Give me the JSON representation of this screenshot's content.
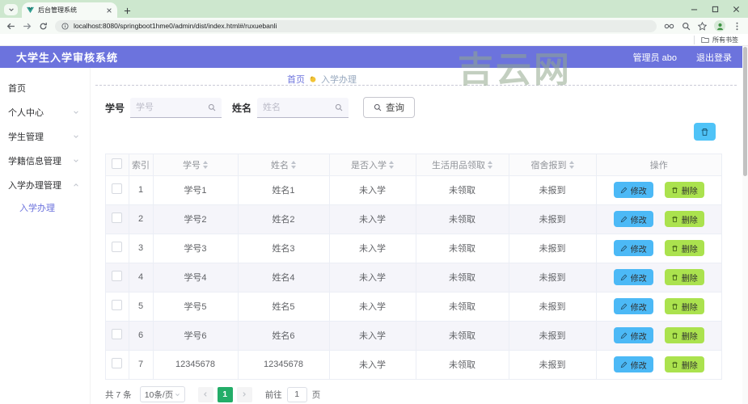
{
  "colors": {
    "accent": "#6c73dd",
    "edit_button": "#4cb9f6",
    "delete_button": "#abe24e",
    "page_active": "#23ad68",
    "batch_button": "#4fc3f7"
  },
  "browser": {
    "tab_title": "后台管理系统",
    "url": "localhost:8080/springboot1hme0/admin/dist/index.html#/ruxuebanli",
    "bookmarks_label": "所有书签"
  },
  "watermark": "吉云网",
  "app_header": {
    "title": "大学生入学审核系统",
    "user": "管理员 abo",
    "logout": "退出登录"
  },
  "breadcrumb": {
    "home": "首页",
    "current": "入学办理"
  },
  "sidebar": {
    "items": [
      {
        "label": "首页",
        "expandable": false
      },
      {
        "label": "个人中心",
        "expandable": true
      },
      {
        "label": "学生管理",
        "expandable": true
      },
      {
        "label": "学籍信息管理",
        "expandable": true
      },
      {
        "label": "入学办理管理",
        "expandable": true,
        "children": [
          {
            "label": "入学办理",
            "active": true
          }
        ]
      }
    ]
  },
  "search": {
    "id_label": "学号",
    "id_placeholder": "学号",
    "name_label": "姓名",
    "name_placeholder": "姓名",
    "query_label": "查询"
  },
  "table": {
    "headers": [
      "索引",
      "学号",
      "姓名",
      "是否入学",
      "生活用品领取",
      "宿舍报到",
      "操作"
    ],
    "edit_label": "修改",
    "delete_label": "删除",
    "rows": [
      {
        "index": "1",
        "student_id": "学号1",
        "name": "姓名1",
        "enrolled": "未入学",
        "supplies": "未领取",
        "dorm": "未报到"
      },
      {
        "index": "2",
        "student_id": "学号2",
        "name": "姓名2",
        "enrolled": "未入学",
        "supplies": "未领取",
        "dorm": "未报到"
      },
      {
        "index": "3",
        "student_id": "学号3",
        "name": "姓名3",
        "enrolled": "未入学",
        "supplies": "未领取",
        "dorm": "未报到"
      },
      {
        "index": "4",
        "student_id": "学号4",
        "name": "姓名4",
        "enrolled": "未入学",
        "supplies": "未领取",
        "dorm": "未报到"
      },
      {
        "index": "5",
        "student_id": "学号5",
        "name": "姓名5",
        "enrolled": "未入学",
        "supplies": "未领取",
        "dorm": "未报到"
      },
      {
        "index": "6",
        "student_id": "学号6",
        "name": "姓名6",
        "enrolled": "未入学",
        "supplies": "未领取",
        "dorm": "未报到"
      },
      {
        "index": "7",
        "student_id": "12345678",
        "name": "12345678",
        "enrolled": "未入学",
        "supplies": "未领取",
        "dorm": "未报到"
      }
    ]
  },
  "pagination": {
    "total": "共 7 条",
    "page_size": "10条/页",
    "current_page": "1",
    "goto_prefix": "前往",
    "goto_value": "1",
    "goto_suffix": "页"
  }
}
